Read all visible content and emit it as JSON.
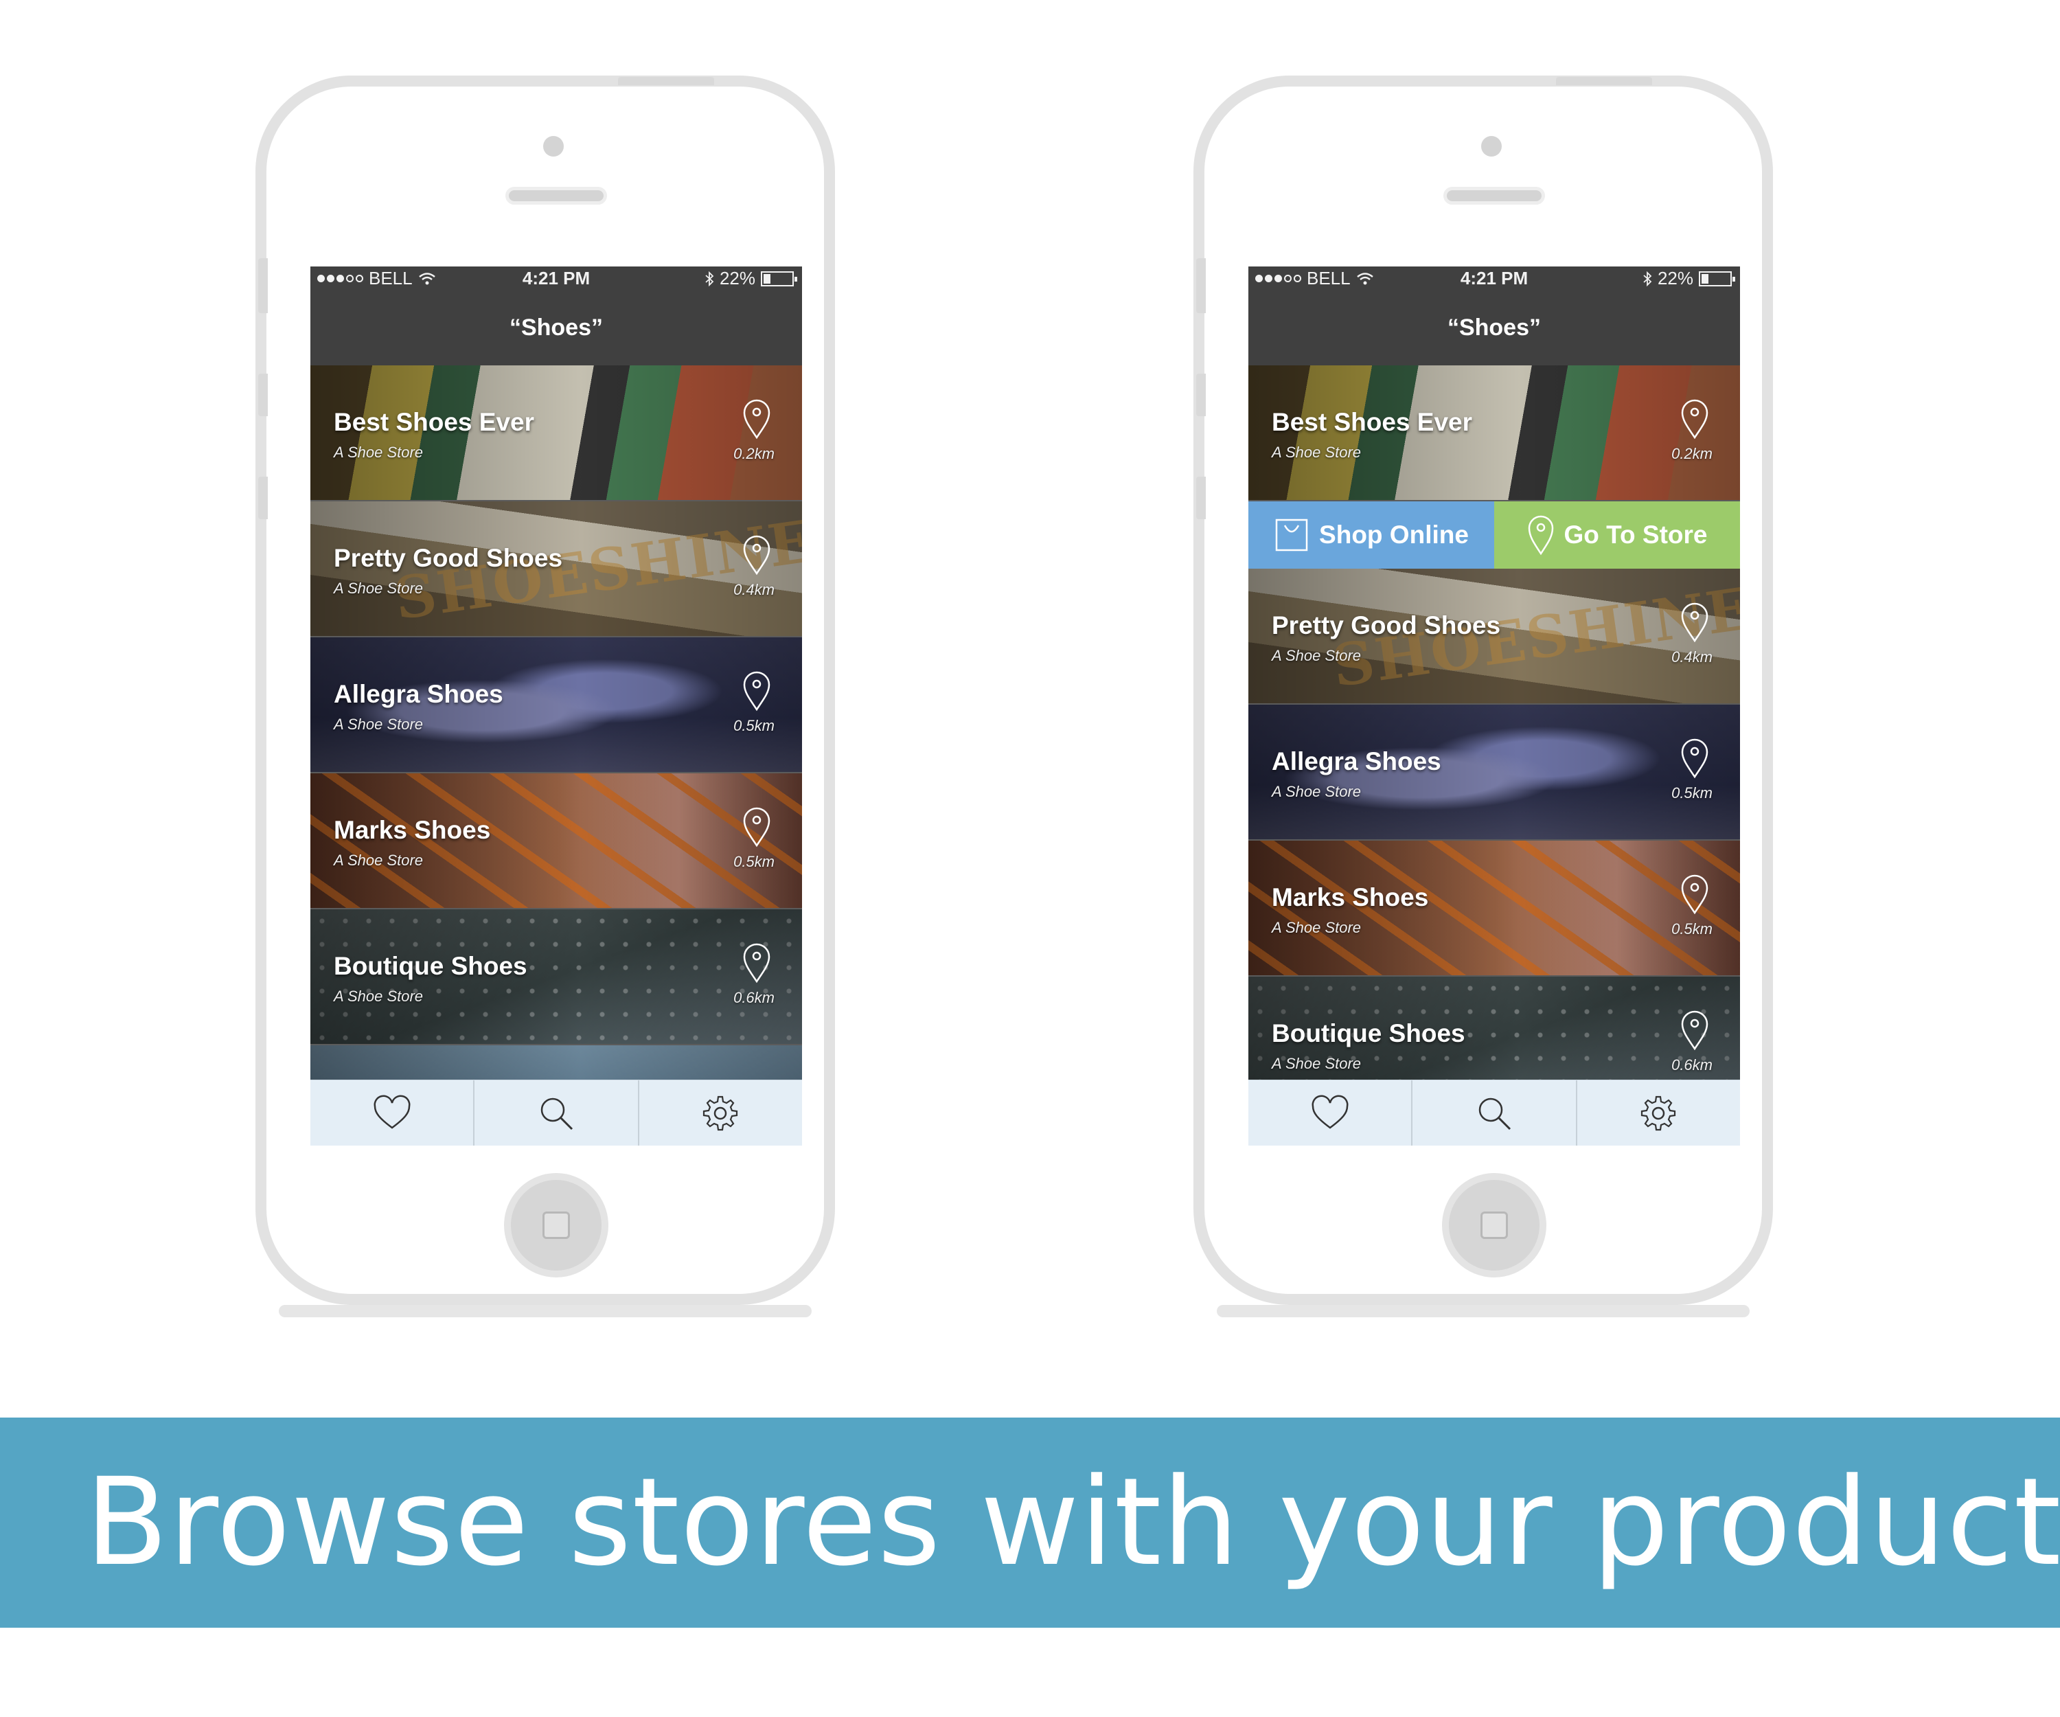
{
  "status_bar": {
    "carrier": "BELL",
    "time": "4:21 PM",
    "battery": "22%",
    "battery_level": 0.22,
    "signal_bars": 3
  },
  "nav_title": "“Shoes”",
  "stores": [
    {
      "name": "Best Shoes Ever",
      "subtitle": "A Shoe Store",
      "distance": "0.2km"
    },
    {
      "name": "Pretty Good Shoes",
      "subtitle": "A Shoe Store",
      "distance": "0.4km"
    },
    {
      "name": "Allegra Shoes",
      "subtitle": "A Shoe Store",
      "distance": "0.5km"
    },
    {
      "name": "Marks Shoes",
      "subtitle": "A Shoe Store",
      "distance": "0.5km"
    },
    {
      "name": "Boutique Shoes",
      "subtitle": "A Shoe Store",
      "distance": "0.6km"
    }
  ],
  "actions": {
    "shop_online": "Shop Online",
    "go_to_store": "Go To Store",
    "shop_color": "#6aa6dc",
    "store_color": "#9ccb6a"
  },
  "tabs": [
    {
      "icon": "heart-icon"
    },
    {
      "icon": "search-icon"
    },
    {
      "icon": "gear-icon"
    }
  ],
  "banner": {
    "text": "Browse stores with your product.",
    "color": "#55a5c4"
  }
}
